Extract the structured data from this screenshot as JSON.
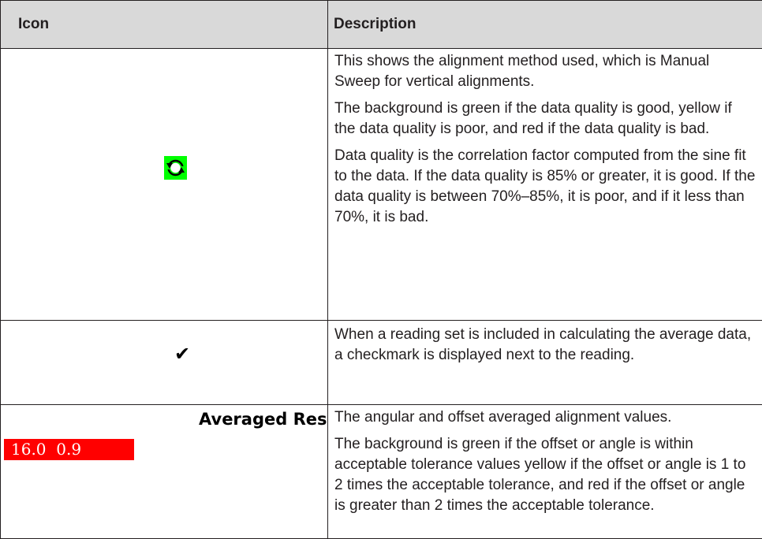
{
  "table": {
    "headers": {
      "icon": "Icon",
      "description": "Description"
    },
    "rows": [
      {
        "icon": "manual-sweep-icon",
        "icon_bg_color": "#00ff00",
        "paragraphs": [
          "This shows the alignment method used, which is Manual Sweep for vertical alignments.",
          "The background is green if the data quality is good, yellow if the data quality is poor, and red if the data quality is bad.",
          "Data quality is the correlation factor computed from the sine fit to the data. If the data quality is 85% or greater, it is good. If the data quality is between 70%–85%, it is poor, and if it less than 70%, it is bad."
        ]
      },
      {
        "icon": "checkmark-icon",
        "paragraphs": [
          "When a reading set is included in calculating the average data, a checkmark is displayed next to the reading."
        ]
      },
      {
        "icon": "averaged-results-badge",
        "icon_title": "Averaged Resul",
        "badge_values": [
          "16.0",
          "0.9"
        ],
        "badge_color": "#ff0000",
        "paragraphs": [
          "The angular and offset averaged alignment values.",
          "The background is green if the offset or angle is within acceptable tolerance values yellow if the offset or angle is 1 to 2 times the acceptable tolerance, and red if the offset or angle is greater than 2 times the acceptable tolerance."
        ]
      }
    ]
  }
}
